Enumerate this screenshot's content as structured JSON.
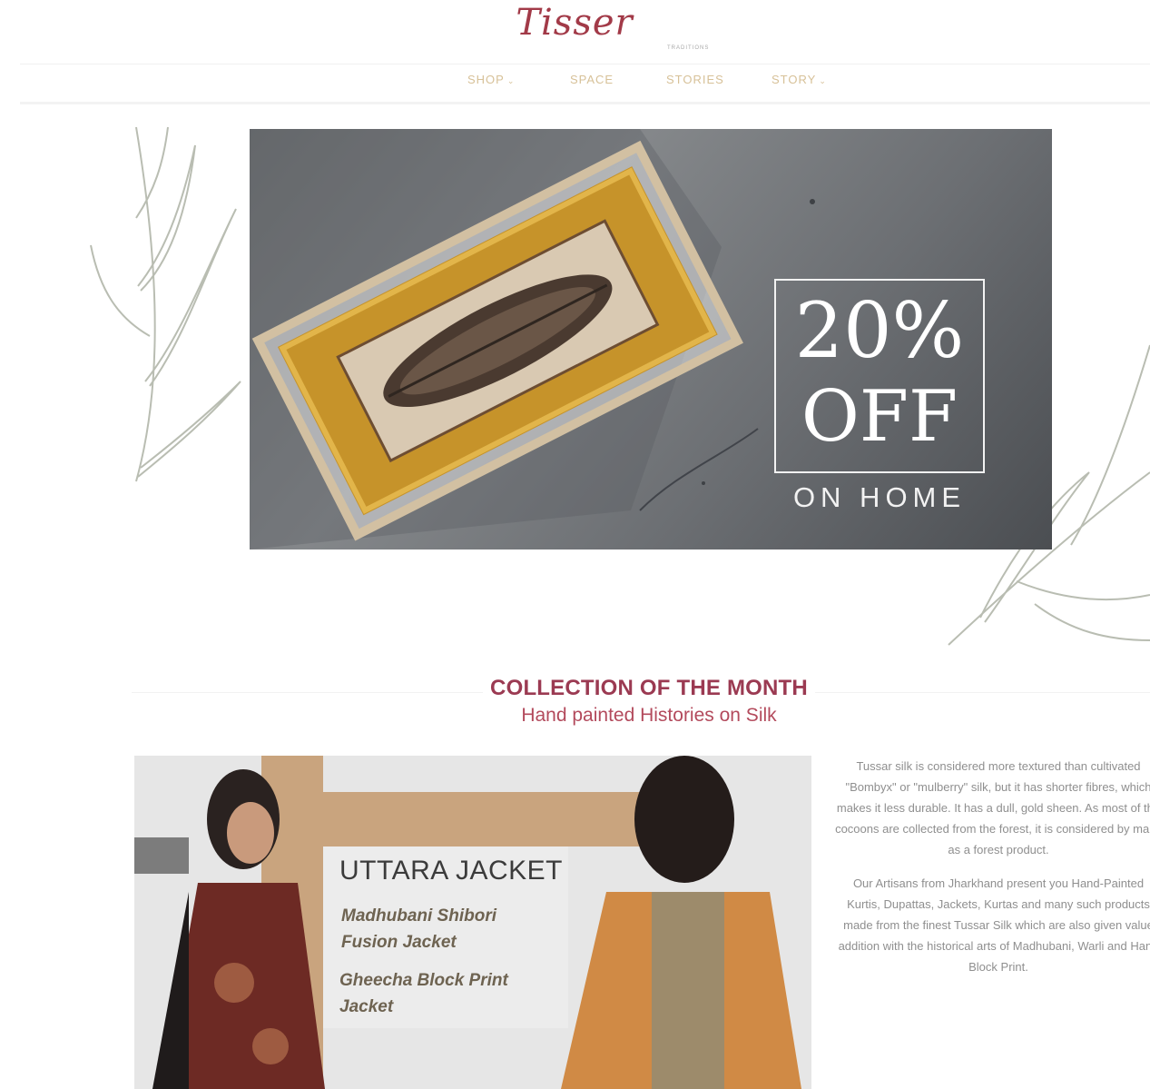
{
  "header": {
    "logo": "Tisser",
    "logo_tagline": "TRADITIONS",
    "nav": [
      {
        "label": "SHOP",
        "has_dropdown": true
      },
      {
        "label": "SPACE",
        "has_dropdown": false
      },
      {
        "label": "STORIES",
        "has_dropdown": false
      },
      {
        "label": "STORY",
        "has_dropdown": true
      }
    ]
  },
  "banner": {
    "discount": "20%",
    "off_label": "OFF",
    "subtitle": "ON HOME"
  },
  "collection": {
    "title": "COLLECTION OF THE MONTH",
    "subtitle": "Hand painted Histories on Silk",
    "promo": {
      "title": "UTTARA JACKET",
      "subtitle_1": "Madhubani Shibori Fusion Jacket",
      "subtitle_2": "Gheecha Block Print Jacket"
    },
    "paragraphs": [
      "Tussar silk is considered more textured than cultivated \"Bombyx\" or \"mulberry\" silk, but it has shorter fibres, which makes it less durable. It has a dull, gold sheen. As most of the cocoons are collected from the forest, it is considered by many as a forest product.",
      "Our Artisans from Jharkhand present you Hand-Painted Kurtis, Dupattas, Jackets, Kurtas and many such products made from the finest Tussar Silk which are also given value addition with the historical arts of Madhubani, Warli and Hand Block Print."
    ]
  },
  "colors": {
    "brand": "#a23a48",
    "nav_text": "#d7c198",
    "section_title": "#9b3a52",
    "leaf_lines": "#b9bdb2"
  }
}
